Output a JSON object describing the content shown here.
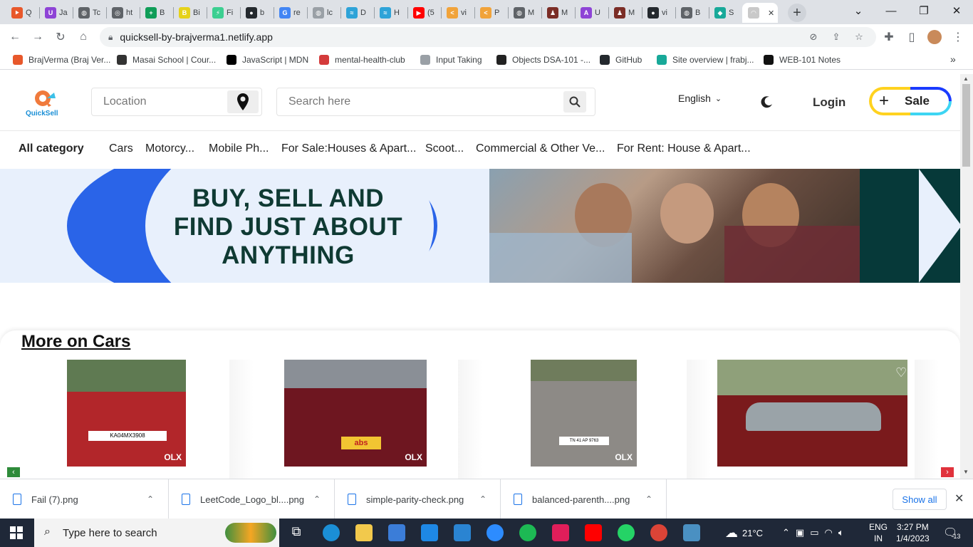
{
  "browser": {
    "tabs": [
      {
        "label": "Q",
        "color": "#e8582b",
        "glyph": "⯈"
      },
      {
        "label": "Ja",
        "color": "#8e44d6",
        "glyph": "U"
      },
      {
        "label": "Tc",
        "color": "#5f6368",
        "glyph": "◍"
      },
      {
        "label": "ht",
        "color": "#5f6368",
        "glyph": "◎"
      },
      {
        "label": "B",
        "color": "#0f9d58",
        "glyph": "+"
      },
      {
        "label": "Bi",
        "color": "#e6d21a",
        "glyph": "B"
      },
      {
        "label": "Fi",
        "color": "#3ccf91",
        "glyph": "⚡"
      },
      {
        "label": "b",
        "color": "#24292e",
        "glyph": "●"
      },
      {
        "label": "re",
        "color": "#4285f4",
        "glyph": "G"
      },
      {
        "label": "lc",
        "color": "#9aa0a6",
        "glyph": "◍"
      },
      {
        "label": "D",
        "color": "#2ea3d8",
        "glyph": "≈"
      },
      {
        "label": "H",
        "color": "#2ea3d8",
        "glyph": "≈"
      },
      {
        "label": "(5",
        "color": "#ff0000",
        "glyph": "▶"
      },
      {
        "label": "vi",
        "color": "#f1a33a",
        "glyph": "<"
      },
      {
        "label": "P",
        "color": "#f1a33a",
        "glyph": "<"
      },
      {
        "label": "M",
        "color": "#5f6368",
        "glyph": "◍"
      },
      {
        "label": "M",
        "color": "#7b2d26",
        "glyph": "♟"
      },
      {
        "label": "U",
        "color": "#8e44d6",
        "glyph": "A"
      },
      {
        "label": "M",
        "color": "#7b2d26",
        "glyph": "♟"
      },
      {
        "label": "vi",
        "color": "#24292e",
        "glyph": "●"
      },
      {
        "label": "B",
        "color": "#5f6368",
        "glyph": "◍"
      },
      {
        "label": "S",
        "color": "#18a999",
        "glyph": "◆"
      },
      {
        "label": "",
        "color": "#c9c9c9",
        "glyph": "◠",
        "active": true
      }
    ],
    "url": "quicksell-by-brajverma1.netlify.app",
    "bookmarks": [
      {
        "label": "BrajVerma (Braj Ver...",
        "color": "#e8582b"
      },
      {
        "label": "Masai School | Cour...",
        "color": "#333333"
      },
      {
        "label": "JavaScript | MDN",
        "color": "#000000"
      },
      {
        "label": "mental-health-club",
        "color": "#d43b3b"
      },
      {
        "label": "Input Taking",
        "color": "#9aa0a6"
      },
      {
        "label": "Objects DSA-101 -...",
        "color": "#222222"
      },
      {
        "label": "GitHub",
        "color": "#24292e"
      },
      {
        "label": "Site overview | frabj...",
        "color": "#18a999"
      },
      {
        "label": "WEB-101 Notes",
        "color": "#111111"
      }
    ]
  },
  "site": {
    "logo_text": "QuickSell",
    "location_placeholder": "Location",
    "search_placeholder": "Search here",
    "language": "English",
    "login_label": "Login",
    "sale_label": "Sale",
    "categories": [
      "All category",
      "Cars",
      "Motorcy...",
      "Mobile Ph...",
      "For Sale:Houses & Apart...",
      "Scoot...",
      "Commercial & Other Ve...",
      "For Rent: House & Apart..."
    ],
    "banner_text": "BUY, SELL AND FIND JUST ABOUT ANYTHING",
    "section_title": "More on Cars",
    "cars": [
      {
        "color": "#b2262a",
        "plate": "KA04MX3908"
      },
      {
        "color": "#6e1620",
        "plate": "abs"
      },
      {
        "color": "#8d8a86",
        "plate": "TN 41 AP 9763"
      },
      {
        "color": "#7a1a1c",
        "plate": ""
      }
    ],
    "watermark": "OLX"
  },
  "downloads": {
    "items": [
      "Fail (7).png",
      "LeetCode_Logo_bl....png",
      "simple-parity-check.png",
      "balanced-parenth....png"
    ],
    "show_all": "Show all"
  },
  "taskbar": {
    "search_placeholder": "Type here to search",
    "weather": "21°C",
    "lang_top": "ENG",
    "lang_bottom": "IN",
    "time": "3:27 PM",
    "date": "1/4/2023",
    "notifications": "13"
  }
}
